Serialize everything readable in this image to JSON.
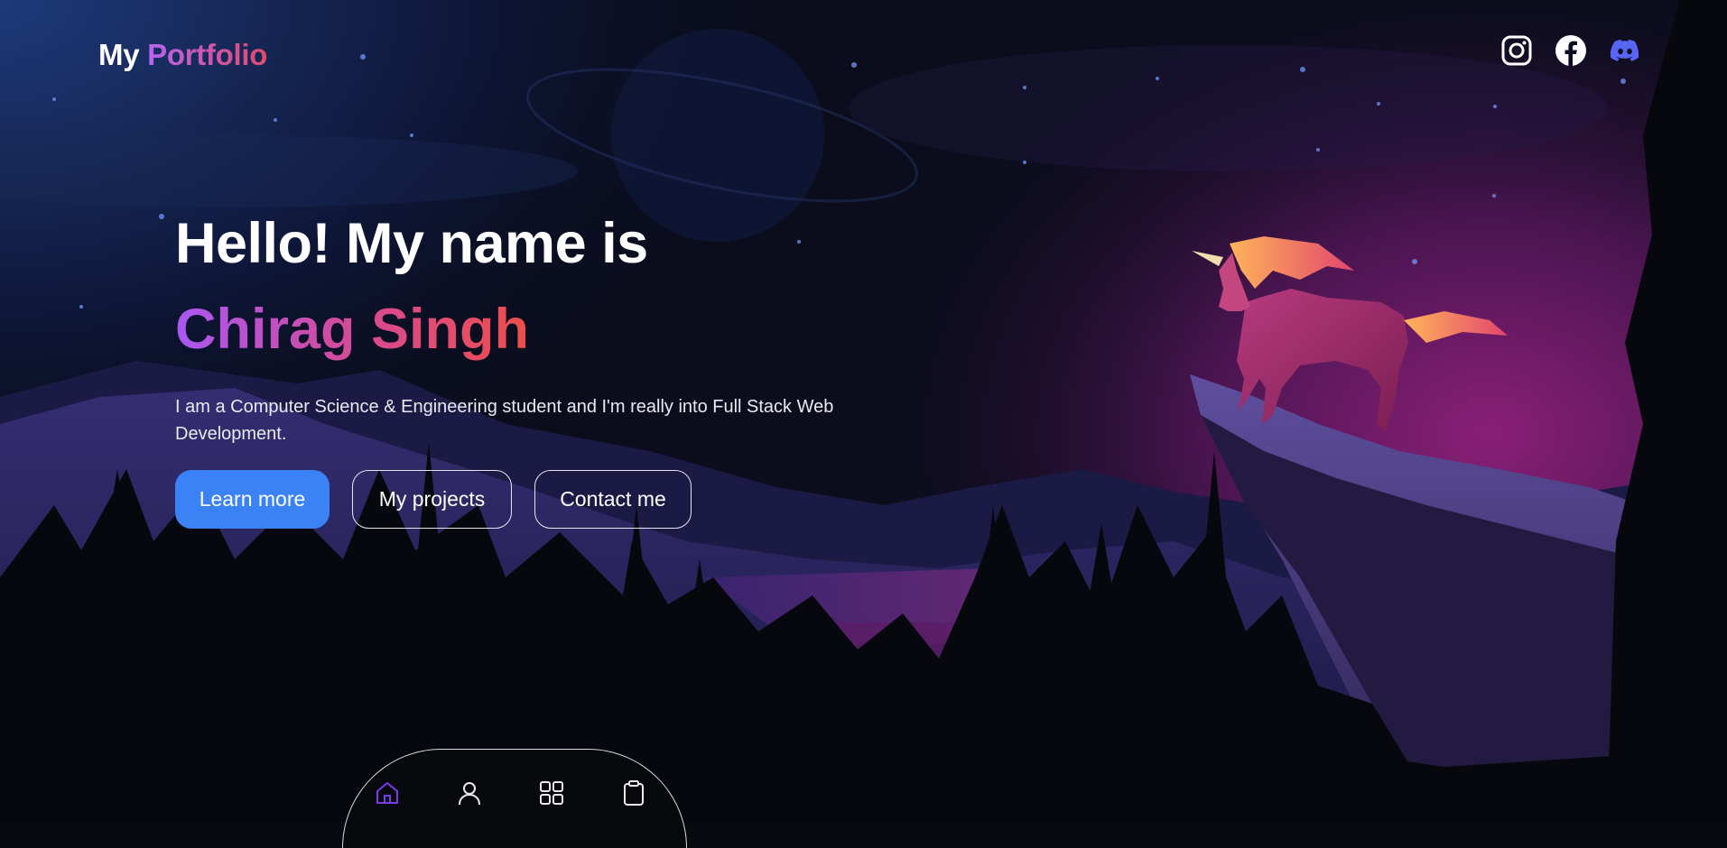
{
  "header": {
    "logo_prefix": "My",
    "logo_accent": "Portfolio",
    "socials": [
      {
        "icon": "instagram-icon"
      },
      {
        "icon": "facebook-icon"
      },
      {
        "icon": "discord-icon",
        "color": "#5865f2"
      }
    ]
  },
  "hero": {
    "greeting": "Hello! My name is",
    "name": "Chirag Singh",
    "description": "I am a Computer Science & Engineering student and I'm really into Full Stack Web Development."
  },
  "buttons": {
    "learn_more": "Learn more",
    "my_projects": "My projects",
    "contact_me": "Contact me"
  },
  "dock": {
    "items": [
      {
        "icon": "home-icon",
        "active": true,
        "color": "#7c3aed"
      },
      {
        "icon": "user-icon"
      },
      {
        "icon": "grid-icon"
      },
      {
        "icon": "clipboard-icon"
      }
    ]
  },
  "colors": {
    "accent_blue": "#3b82f6",
    "gradient_start": "#a957f2",
    "gradient_end": "#ee4e4b",
    "background": "#07090f"
  }
}
